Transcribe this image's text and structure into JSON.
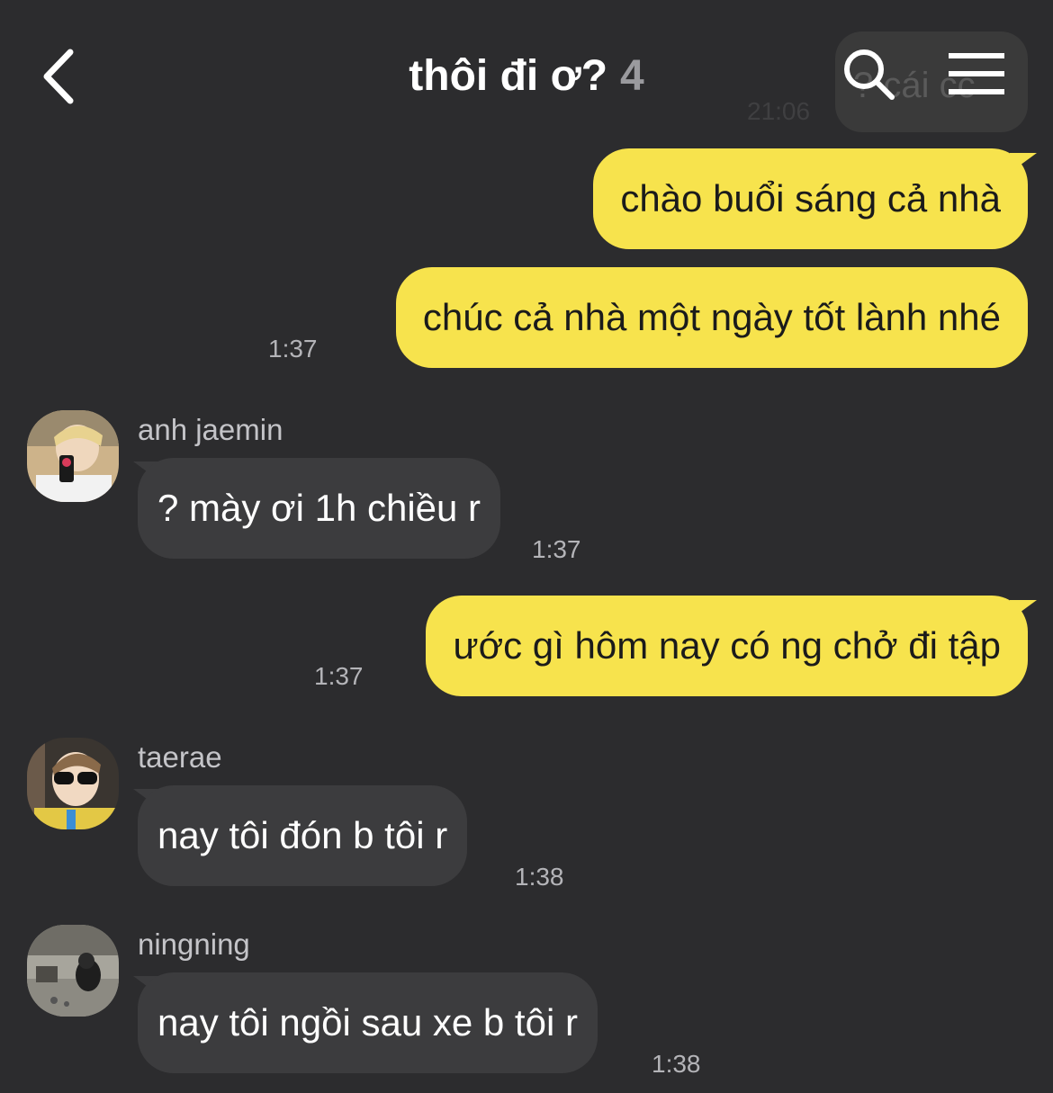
{
  "header": {
    "title": "thôi đi ơ?",
    "member_count": "4",
    "back_icon": "chevron-left-icon",
    "search_icon": "search-icon",
    "menu_icon": "hamburger-menu-icon"
  },
  "peek": {
    "text": "? cái cc",
    "time": "21:06"
  },
  "messages": [
    {
      "direction": "out",
      "text": "chào buổi sáng cả nhà",
      "time": ""
    },
    {
      "direction": "out",
      "text": "chúc cả nhà một ngày tốt lành nhé",
      "time": "1:37"
    },
    {
      "direction": "in",
      "sender": "anh jaemin",
      "text": "? mày ơi 1h chiều r",
      "time": "1:37"
    },
    {
      "direction": "out",
      "text": "ước gì hôm nay có ng chở đi tập",
      "time": "1:37"
    },
    {
      "direction": "in",
      "sender": "taerae",
      "text": "nay tôi đón b tôi r",
      "time": "1:38"
    },
    {
      "direction": "in",
      "sender": "ningning",
      "text": "nay tôi ngồi sau xe b tôi r",
      "time": "1:38"
    }
  ],
  "colors": {
    "background": "#2c2c2e",
    "outgoing_bubble": "#f7e34d",
    "incoming_bubble": "#3c3c3e",
    "timestamp": "#b4b4b8",
    "member_count": "#9a9a9e"
  }
}
